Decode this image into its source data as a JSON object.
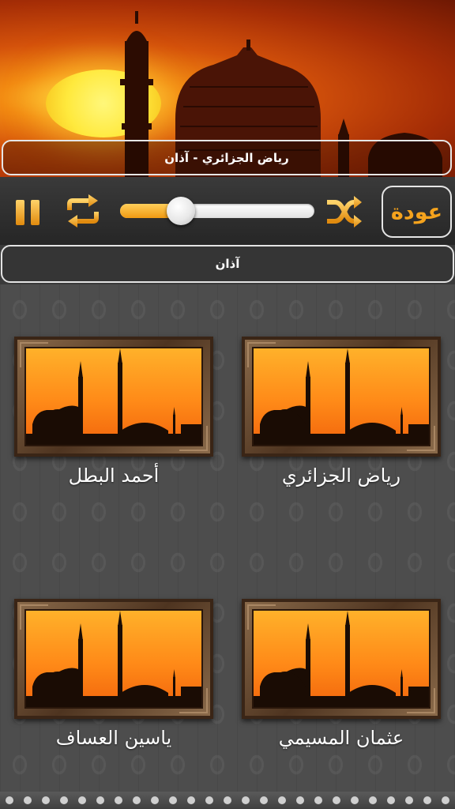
{
  "header": {
    "now_playing": "رياض الجزائري - آذان"
  },
  "player": {
    "back_label": "عودة",
    "progress": 0.24,
    "pause_icon": "pause-icon",
    "repeat_icon": "repeat-icon",
    "shuffle_icon": "shuffle-icon"
  },
  "category": {
    "title": "آذان"
  },
  "reciters": [
    {
      "name": "رياض الجزائري"
    },
    {
      "name": "أحمد البطل"
    },
    {
      "name": "عثمان المسيمي"
    },
    {
      "name": "ياسين العساف"
    }
  ],
  "colors": {
    "accent": "#f5a31d",
    "background": "#4d4d4d"
  }
}
